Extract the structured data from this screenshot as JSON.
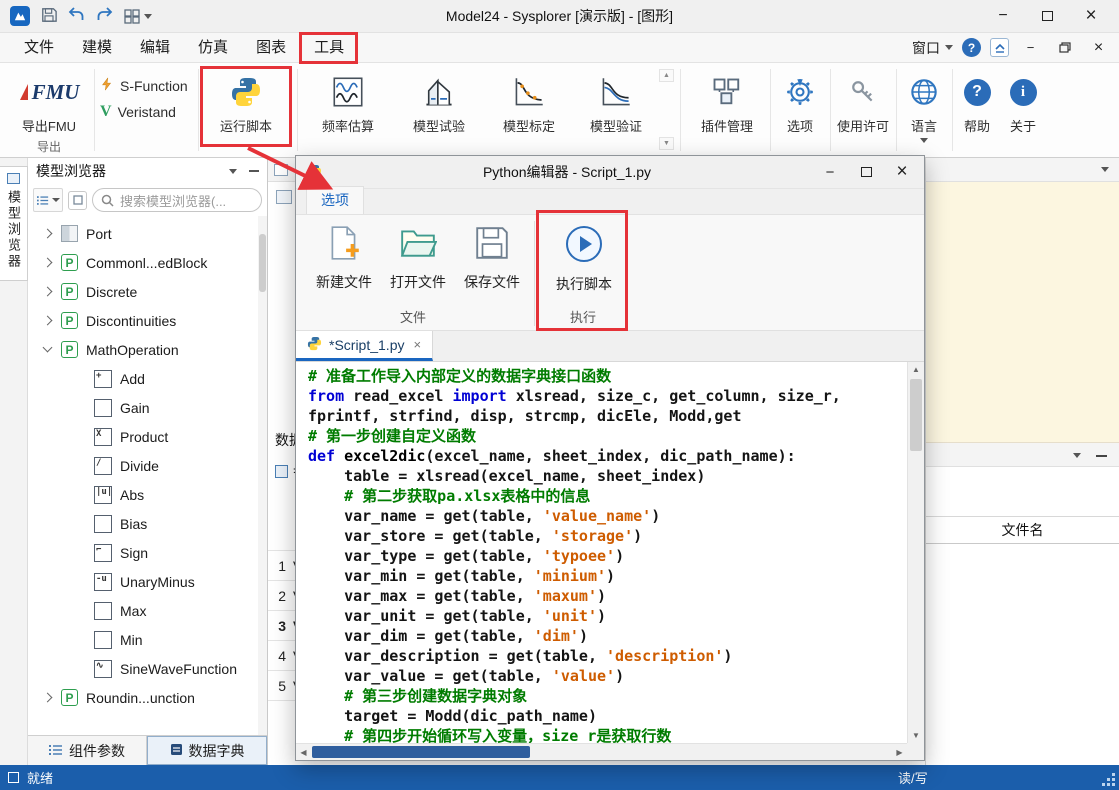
{
  "titlebar": {
    "title": "Model24 - Sysplorer [演示版] - [图形]"
  },
  "menubar": {
    "items": [
      "文件",
      "建模",
      "编辑",
      "仿真",
      "图表",
      "工具"
    ],
    "window_menu": "窗口"
  },
  "ribbon": {
    "fmu_logo": "FMU",
    "export_fmu": "导出FMU",
    "export_group": "导出",
    "s_function": "S-Function",
    "veristand": "Veristand",
    "veristand_glyph": "V",
    "run_script": "运行脚本",
    "freq_estimation": "频率估算",
    "model_test": "模型试验",
    "model_calibration": "模型标定",
    "model_validation": "模型验证",
    "plugin_manager": "插件管理",
    "options": "选项",
    "license": "使用许可",
    "language": "语言",
    "help": "帮助",
    "about": "关于"
  },
  "sidebar": {
    "vertical_tab": "模型浏览器",
    "panel_title": "模型浏览器",
    "search_placeholder": "搜索模型浏览器(...",
    "tree": [
      {
        "label": "Port",
        "icon": "port",
        "chevron": "collapsed",
        "level": 0
      },
      {
        "label": "Commonl...edBlock",
        "icon": "p",
        "chevron": "collapsed",
        "level": 0
      },
      {
        "label": "Discrete",
        "icon": "p",
        "chevron": "collapsed",
        "level": 0
      },
      {
        "label": "Discontinuities",
        "icon": "p",
        "chevron": "collapsed",
        "level": 0
      },
      {
        "label": "MathOperation",
        "icon": "p",
        "chevron": "expanded",
        "level": 0
      },
      {
        "label": "Add",
        "icon": "op",
        "glyph": "+",
        "level": 1
      },
      {
        "label": "Gain",
        "icon": "op",
        "glyph": "",
        "level": 1
      },
      {
        "label": "Product",
        "icon": "op",
        "glyph": "X",
        "level": 1
      },
      {
        "label": "Divide",
        "icon": "op",
        "glyph": "/",
        "level": 1
      },
      {
        "label": "Abs",
        "icon": "op",
        "glyph": "|u|",
        "level": 1
      },
      {
        "label": "Bias",
        "icon": "op",
        "glyph": "",
        "level": 1
      },
      {
        "label": "Sign",
        "icon": "op",
        "glyph": "⌐",
        "level": 1
      },
      {
        "label": "UnaryMinus",
        "icon": "op",
        "glyph": "-u",
        "level": 1
      },
      {
        "label": "Max",
        "icon": "op",
        "glyph": "",
        "level": 1
      },
      {
        "label": "Min",
        "icon": "op",
        "glyph": "",
        "level": 1
      },
      {
        "label": "SineWaveFunction",
        "icon": "op",
        "glyph": "∿",
        "level": 1
      },
      {
        "label": "Roundin...unction",
        "icon": "p",
        "chevron": "collapsed",
        "level": 0
      }
    ],
    "bottom_tabs": [
      {
        "label": "组件参数",
        "active": false
      },
      {
        "label": "数据字典",
        "active": true
      }
    ]
  },
  "center": {
    "data_label": "数据",
    "param_label": "参",
    "rows": [
      {
        "num": "1",
        "text": "V",
        "bold": false
      },
      {
        "num": "2",
        "text": "V",
        "bold": false
      },
      {
        "num": "3",
        "text": "V",
        "bold": true
      },
      {
        "num": "4",
        "text": "V",
        "bold": false
      },
      {
        "num": "5",
        "text": "V",
        "bold": false
      }
    ]
  },
  "right_panel": {
    "file_name_header": "文件名"
  },
  "statusbar": {
    "ready": "就绪",
    "readwrite": "读/写"
  },
  "dialog": {
    "title": "Python编辑器 - Script_1.py",
    "menu_tab": "选项",
    "toolbar": [
      {
        "label": "新建文件"
      },
      {
        "label": "打开文件"
      },
      {
        "label": "保存文件"
      },
      {
        "label": "执行脚本"
      }
    ],
    "group_file": "文件",
    "group_run": "执行",
    "tab_title": "*Script_1.py",
    "code_lines": [
      [
        {
          "c": "cm",
          "t": "# 准备工作导入内部定义的数据字典接口函数"
        }
      ],
      [
        {
          "c": "kw",
          "t": "from"
        },
        {
          "c": "pl",
          "t": " read_excel "
        },
        {
          "c": "kw",
          "t": "import"
        },
        {
          "c": "pl",
          "t": " xlsread, size_c, get_column, size_r,"
        }
      ],
      [
        {
          "c": "pl",
          "t": "fprintf, strfind, disp, strcmp, dicEle, Modd,get"
        }
      ],
      [
        {
          "c": "cm",
          "t": "# 第一步创建自定义函数"
        }
      ],
      [
        {
          "c": "kw",
          "t": "def"
        },
        {
          "c": "pl",
          "t": " "
        },
        {
          "c": "fn",
          "t": "excel2dic"
        },
        {
          "c": "pl",
          "t": "(excel_name, sheet_index, dic_path_name):"
        }
      ],
      [
        {
          "c": "pl",
          "t": "    table = xlsread(excel_name, sheet_index)"
        }
      ],
      [
        {
          "c": "cm",
          "t": "    # 第二步获取pa.xlsx表格中的信息"
        }
      ],
      [
        {
          "c": "pl",
          "t": "    var_name = get(table, "
        },
        {
          "c": "st",
          "t": "'value_name'"
        },
        {
          "c": "pl",
          "t": ")"
        }
      ],
      [
        {
          "c": "pl",
          "t": "    var_store = get(table, "
        },
        {
          "c": "st",
          "t": "'storage'"
        },
        {
          "c": "pl",
          "t": ")"
        }
      ],
      [
        {
          "c": "pl",
          "t": "    var_type = get(table, "
        },
        {
          "c": "st",
          "t": "'typoee'"
        },
        {
          "c": "pl",
          "t": ")"
        }
      ],
      [
        {
          "c": "pl",
          "t": "    var_min = get(table, "
        },
        {
          "c": "st",
          "t": "'minium'"
        },
        {
          "c": "pl",
          "t": ")"
        }
      ],
      [
        {
          "c": "pl",
          "t": "    var_max = get(table, "
        },
        {
          "c": "st",
          "t": "'maxum'"
        },
        {
          "c": "pl",
          "t": ")"
        }
      ],
      [
        {
          "c": "pl",
          "t": "    var_unit = get(table, "
        },
        {
          "c": "st",
          "t": "'unit'"
        },
        {
          "c": "pl",
          "t": ")"
        }
      ],
      [
        {
          "c": "pl",
          "t": "    var_dim = get(table, "
        },
        {
          "c": "st",
          "t": "'dim'"
        },
        {
          "c": "pl",
          "t": ")"
        }
      ],
      [
        {
          "c": "pl",
          "t": "    var_description = get(table, "
        },
        {
          "c": "st",
          "t": "'description'"
        },
        {
          "c": "pl",
          "t": ")"
        }
      ],
      [
        {
          "c": "pl",
          "t": "    var_value = get(table, "
        },
        {
          "c": "st",
          "t": "'value'"
        },
        {
          "c": "pl",
          "t": ")"
        }
      ],
      [
        {
          "c": "cm",
          "t": "    # 第三步创建数据字典对象"
        }
      ],
      [
        {
          "c": "pl",
          "t": "    target = Modd(dic_path_name)"
        }
      ],
      [
        {
          "c": "cm",
          "t": "    # 第四步开始循环写入变量，size_r是获取行数"
        }
      ]
    ]
  }
}
